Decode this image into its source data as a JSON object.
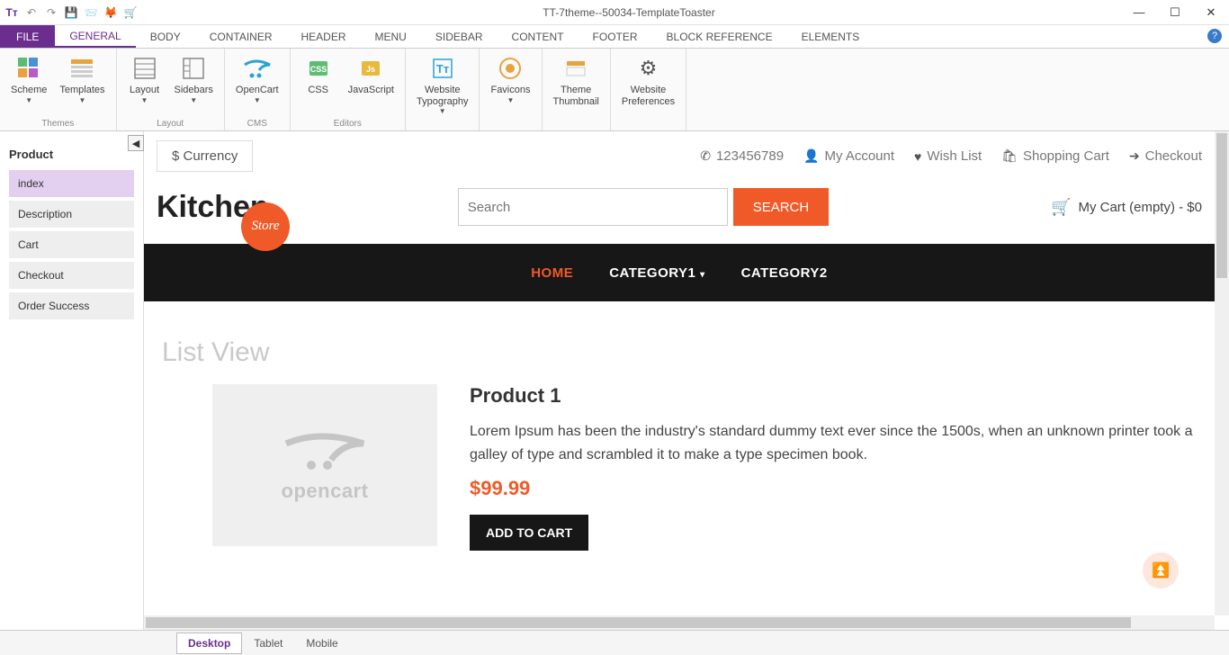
{
  "titlebar": {
    "title": "TT-7theme--50034-TemplateToaster"
  },
  "ribbon": {
    "file": "FILE",
    "tabs": [
      "GENERAL",
      "BODY",
      "CONTAINER",
      "HEADER",
      "MENU",
      "SIDEBAR",
      "CONTENT",
      "FOOTER",
      "BLOCK REFERENCE",
      "ELEMENTS"
    ],
    "active_tab": 0,
    "groups": [
      {
        "label": "Themes",
        "items": [
          {
            "label": "Scheme",
            "caret": true
          },
          {
            "label": "Templates",
            "caret": true
          }
        ]
      },
      {
        "label": "Layout",
        "items": [
          {
            "label": "Layout",
            "caret": true
          },
          {
            "label": "Sidebars",
            "caret": true
          }
        ]
      },
      {
        "label": "CMS",
        "items": [
          {
            "label": "OpenCart",
            "caret": true
          }
        ]
      },
      {
        "label": "Editors",
        "items": [
          {
            "label": "CSS",
            "caret": false
          },
          {
            "label": "JavaScript",
            "caret": false
          }
        ]
      },
      {
        "label": "",
        "items": [
          {
            "label": "Website\nTypography",
            "caret": true
          }
        ]
      },
      {
        "label": "",
        "items": [
          {
            "label": "Favicons",
            "caret": true
          }
        ]
      },
      {
        "label": "",
        "items": [
          {
            "label": "Theme\nThumbnail",
            "caret": false
          }
        ]
      },
      {
        "label": "",
        "items": [
          {
            "label": "Website\nPreferences",
            "caret": false
          }
        ]
      }
    ]
  },
  "left_panel": {
    "title": "Product",
    "items": [
      "index",
      "Description",
      "Cart",
      "Checkout",
      "Order Success"
    ],
    "selected": 0
  },
  "site": {
    "currency_label": "$ Currency",
    "top_links": {
      "phone": "123456789",
      "account": "My Account",
      "wishlist": "Wish List",
      "cart": "Shopping Cart",
      "checkout": "Checkout"
    },
    "logo_main": "Kitchen",
    "logo_badge": "Store",
    "search_placeholder": "Search",
    "search_button": "SEARCH",
    "cart_text": "My Cart (empty) - $0",
    "nav": [
      {
        "label": "HOME",
        "active": true
      },
      {
        "label": "CATEGORY1",
        "caret": true
      },
      {
        "label": "CATEGORY2"
      }
    ],
    "list_title": "List View",
    "product": {
      "name": "Product 1",
      "desc": "Lorem Ipsum has been the industry's standard dummy text ever since the 1500s, when an unknown printer took a galley of type and scrambled it to make a type specimen book.",
      "price": "$99.99",
      "add_label": "ADD TO CART",
      "placeholder_text": "opencart"
    }
  },
  "bottom": {
    "tabs": [
      "Desktop",
      "Tablet",
      "Mobile"
    ],
    "active": 0
  }
}
